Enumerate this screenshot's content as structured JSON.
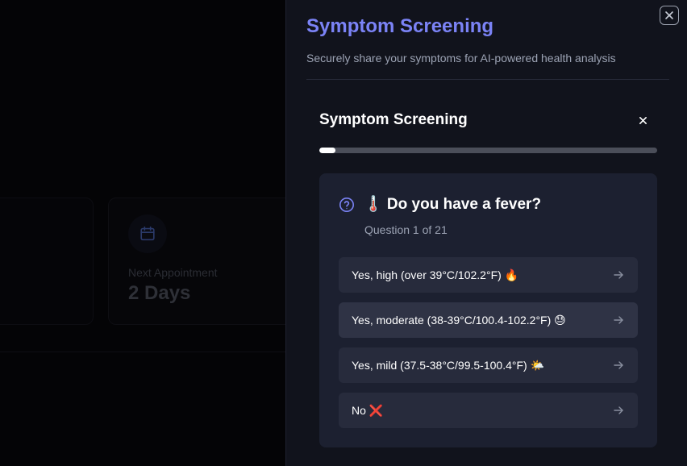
{
  "background": {
    "card_label": "Next Appointment",
    "card_value": "2 Days",
    "card_icon": "calendar-icon"
  },
  "sheet": {
    "title": "Symptom Screening",
    "subtitle": "Securely share your symptoms for AI-powered health analysis",
    "close_icon": "close-icon",
    "accent_color": "#7b83f6"
  },
  "panel": {
    "title": "Symptom Screening",
    "close_icon": "x-icon",
    "progress_fraction": 0.0476
  },
  "question": {
    "icon": "question-circle-icon",
    "title": "🌡️ Do you have a fever?",
    "counter": "Question 1 of 21",
    "options": [
      {
        "label": "Yes, high (over 39°C/102.2°F) 🔥"
      },
      {
        "label": "Yes, moderate (38-39°C/100.4-102.2°F) 😓"
      },
      {
        "label": "Yes, mild (37.5-38°C/99.5-100.4°F) 🌤️"
      },
      {
        "label": "No ❌"
      }
    ]
  }
}
